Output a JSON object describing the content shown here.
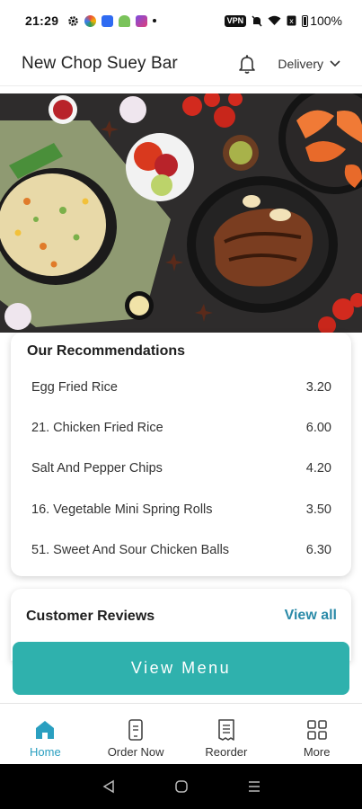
{
  "status_bar": {
    "time": "21:29",
    "battery": "100%",
    "vpn": "VPN"
  },
  "header": {
    "title": "New Chop Suey Bar",
    "delivery_label": "Delivery"
  },
  "recommendations": {
    "title": "Our Recommendations",
    "items": [
      {
        "name": "Egg Fried Rice",
        "price": "3.20"
      },
      {
        "name": "21. Chicken Fried Rice",
        "price": "6.00"
      },
      {
        "name": "Salt And Pepper Chips",
        "price": "4.20"
      },
      {
        "name": "16. Vegetable Mini Spring Rolls",
        "price": "3.50"
      },
      {
        "name": "51. Sweet And Sour Chicken Balls",
        "price": "6.30"
      }
    ]
  },
  "reviews": {
    "title": "Customer Reviews",
    "view_all": "View all"
  },
  "cta": {
    "label": "View Menu",
    "color": "#2fb1ad"
  },
  "bottom_nav": {
    "items": [
      {
        "label": "Home",
        "icon": "home-icon",
        "active": true
      },
      {
        "label": "Order Now",
        "icon": "order-phone-icon"
      },
      {
        "label": "Reorder",
        "icon": "receipt-icon"
      },
      {
        "label": "More",
        "icon": "grid-icon"
      }
    ]
  },
  "colors": {
    "accent": "#2a9fc0",
    "button": "#2fb1ad",
    "link": "#2a8aa8"
  }
}
